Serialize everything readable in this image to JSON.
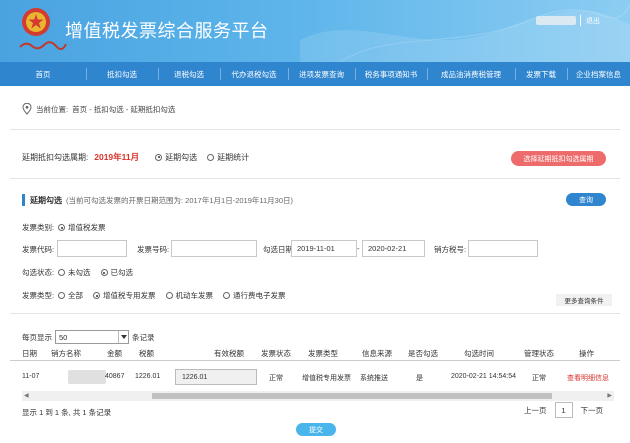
{
  "header": {
    "title": "增值税发票综合服务平台",
    "logout": "退出",
    "emblem_icon": "national-emblem-icon",
    "brand_icon": "tax-brand-calligraphy-icon"
  },
  "nav": {
    "items": [
      "首页",
      "抵扣勾选",
      "退税勾选",
      "代办退税勾选",
      "进项发票查询",
      "税务事项通知书",
      "成品油消费税管理",
      "发票下载",
      "企业档案信息"
    ]
  },
  "breadcrumb": {
    "label": "当前位置:",
    "path": "首页 - 抵扣勾选 - 延期抵扣勾选"
  },
  "period": {
    "label": "延期抵扣勾选属期:",
    "value": "2019年11月",
    "options": [
      "延期勾选",
      "延期统计"
    ],
    "selected": 0,
    "choose_button": "选择延期抵扣勾选属期"
  },
  "section": {
    "title": "延期勾选",
    "hint": "(当前可勾选发票的开票日期范围为: 2017年1月1日-2019年11月30日)",
    "query_button": "查询"
  },
  "form": {
    "invoice_category_label": "发票类别:",
    "invoice_category_value": "增值税发票",
    "invoice_code_label": "发票代码:",
    "invoice_code_value": "",
    "invoice_number_label": "发票号码:",
    "invoice_number_value": "",
    "check_date_label": "勾选日期:",
    "date_from": "2019-11-01",
    "date_sep": "-",
    "date_to": "2020-02-21",
    "seller_tax_label": "销方税号:",
    "seller_tax_value": "",
    "check_status_label": "勾选状态:",
    "check_status_options": [
      "未勾选",
      "已勾选"
    ],
    "check_status_selected": 1,
    "invoice_type_label": "发票类型:",
    "invoice_type_options": [
      "全部",
      "增值税专用发票",
      "机动车发票",
      "通行费电子发票"
    ],
    "invoice_type_selected": 1,
    "more_conditions": "更多查询条件"
  },
  "table": {
    "page_size_label": "每页显示",
    "page_size": "50",
    "page_size_suffix": "条记录",
    "headers": [
      "日期",
      "销方名称",
      "金额",
      "税额",
      "有效税额",
      "发票状态",
      "发票类型",
      "信息来源",
      "是否勾选",
      "勾选时间",
      "管理状态",
      "操作"
    ],
    "rows": [
      {
        "date": "11-07",
        "amount": "40867",
        "tax": "1226.01",
        "valid_tax": "1226.01",
        "status": "正常",
        "type": "增值税专用发票",
        "source": "系统推送",
        "checked": "是",
        "check_time": "2020-02-21 14:54:54",
        "mgmt_status": "正常",
        "action": "查看明细信息"
      }
    ],
    "summary": "显示 1 到 1 条, 共 1 条记录",
    "pager": {
      "prev": "上一页",
      "current": "1",
      "next": "下一页"
    }
  },
  "submit_button": "提交",
  "colors": {
    "nav": "#2f86cf",
    "accent_red": "#d8322a",
    "button_red": "#ee6b6b",
    "header_start": "#4aa3e0"
  }
}
